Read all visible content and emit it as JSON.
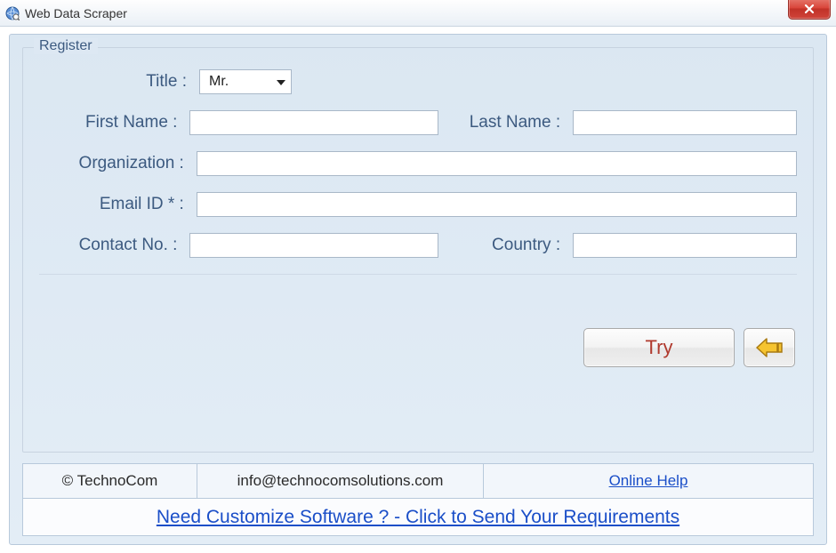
{
  "window": {
    "title": "Web Data Scraper"
  },
  "form": {
    "legend": "Register",
    "labels": {
      "title": "Title :",
      "first_name": "First Name :",
      "last_name": "Last Name :",
      "organization": "Organization :",
      "email": "Email ID * :",
      "contact": "Contact No. :",
      "country": "Country :"
    },
    "title_select": {
      "value": "Mr."
    },
    "values": {
      "first_name": "",
      "last_name": "",
      "organization": "",
      "email": "",
      "contact": "",
      "country": ""
    }
  },
  "buttons": {
    "try": "Try"
  },
  "footer": {
    "copyright": "© TechnoCom",
    "email": "info@technocomsolutions.com",
    "help_link": "Online Help",
    "customize_link": "Need Customize Software ? - Click to Send Your Requirements"
  }
}
